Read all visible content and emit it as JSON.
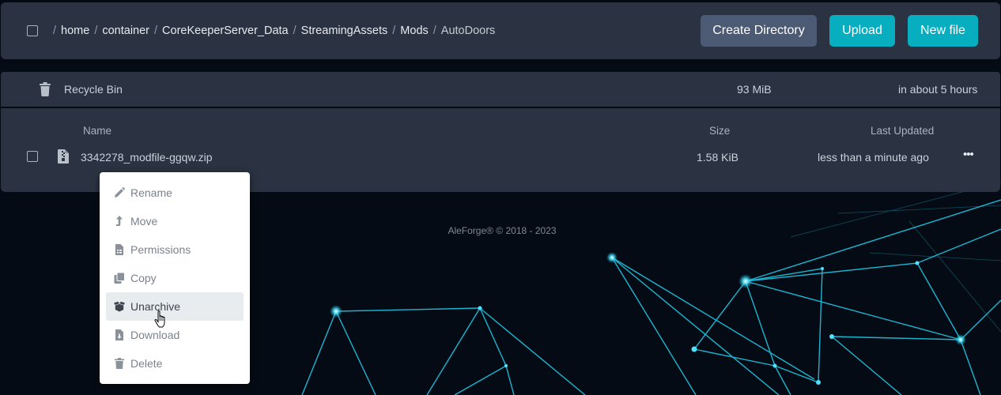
{
  "breadcrumb": {
    "root_separator": "/",
    "separator": "/",
    "segments": [
      "home",
      "container",
      "CoreKeeperServer_Data",
      "StreamingAssets",
      "Mods",
      "AutoDoors"
    ]
  },
  "toolbar": {
    "create_directory_label": "Create Directory",
    "upload_label": "Upload",
    "new_file_label": "New file"
  },
  "recycle_bin": {
    "label": "Recycle Bin",
    "size": "93 MiB",
    "expires": "in about 5 hours"
  },
  "file_table": {
    "headers": {
      "name": "Name",
      "size": "Size",
      "updated": "Last Updated"
    },
    "rows": [
      {
        "name": "3342278_modfile-ggqw.zip",
        "size": "1.58 KiB",
        "updated": "less than a minute ago",
        "icon": "zip-file-icon"
      }
    ],
    "row_actions_label": "•••"
  },
  "context_menu": {
    "items": [
      {
        "label": "Rename",
        "icon": "pencil-icon"
      },
      {
        "label": "Move",
        "icon": "move-arrow-icon"
      },
      {
        "label": "Permissions",
        "icon": "permissions-file-icon"
      },
      {
        "label": "Copy",
        "icon": "copy-icon"
      },
      {
        "label": "Unarchive",
        "icon": "box-open-icon",
        "highlighted": true
      },
      {
        "label": "Download",
        "icon": "download-file-icon"
      },
      {
        "label": "Delete",
        "icon": "trash-icon"
      }
    ]
  },
  "footer": {
    "copyright": "AleForge® © 2018 - 2023"
  },
  "colors": {
    "page_background": "#050b14",
    "panel": "#2b3342",
    "primary_button": "#07aebf",
    "secondary_button": "#4c5a74",
    "network_lines": "#1ec8e6"
  }
}
